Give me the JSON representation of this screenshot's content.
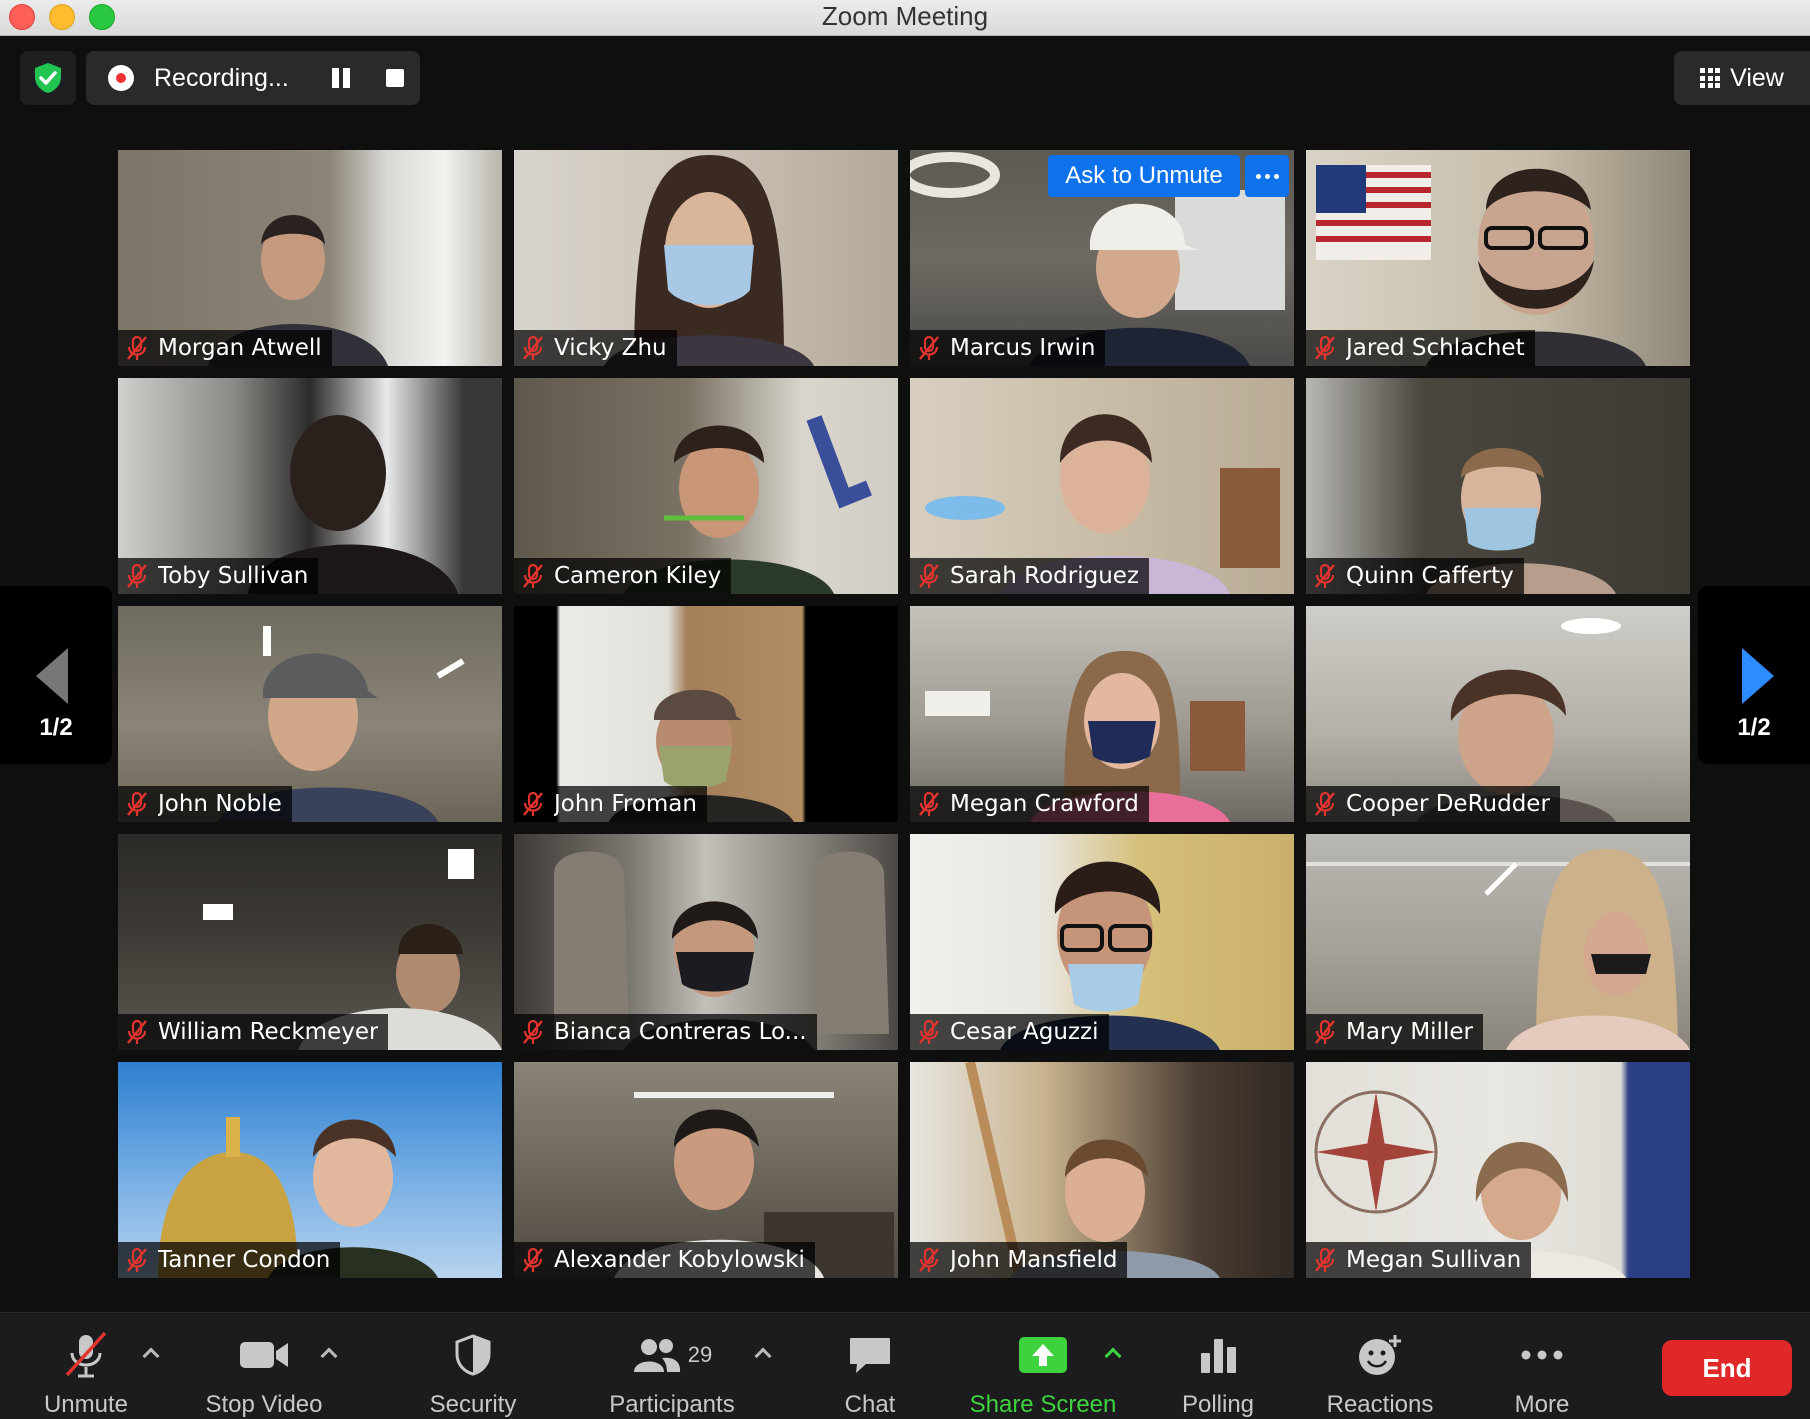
{
  "window": {
    "title": "Zoom Meeting"
  },
  "topbar": {
    "security_icon": "green-shield-check-icon",
    "recording_label": "Recording...",
    "view_label": "View"
  },
  "pagination": {
    "left": "1/2",
    "right": "1/2"
  },
  "tile_actions": {
    "ask_to_unmute": "Ask to Unmute"
  },
  "participants_tiles": [
    {
      "name": "Morgan Atwell"
    },
    {
      "name": "Vicky Zhu"
    },
    {
      "name": "Marcus Irwin"
    },
    {
      "name": "Jared Schlachet"
    },
    {
      "name": "Toby Sullivan"
    },
    {
      "name": "Cameron Kiley"
    },
    {
      "name": "Sarah Rodriguez"
    },
    {
      "name": "Quinn Cafferty"
    },
    {
      "name": "John Noble"
    },
    {
      "name": "John Froman"
    },
    {
      "name": "Megan Crawford"
    },
    {
      "name": "Cooper DeRudder"
    },
    {
      "name": "William Reckmeyer"
    },
    {
      "name": "Bianca Contreras Lo..."
    },
    {
      "name": "Cesar Aguzzi"
    },
    {
      "name": "Mary Miller"
    },
    {
      "name": "Tanner Condon"
    },
    {
      "name": "Alexander Kobylowski"
    },
    {
      "name": "John Mansfield"
    },
    {
      "name": "Megan Sullivan"
    }
  ],
  "toolbar": {
    "unmute": "Unmute",
    "stop_video": "Stop Video",
    "security": "Security",
    "participants": "Participants",
    "participants_count": "29",
    "chat": "Chat",
    "share_screen": "Share Screen",
    "polling": "Polling",
    "reactions": "Reactions",
    "more": "More",
    "end": "End"
  },
  "colors": {
    "accent_blue": "#0e72ed",
    "share_green": "#3ed33e",
    "end_red": "#e02828",
    "muted_red": "#e0342f"
  }
}
